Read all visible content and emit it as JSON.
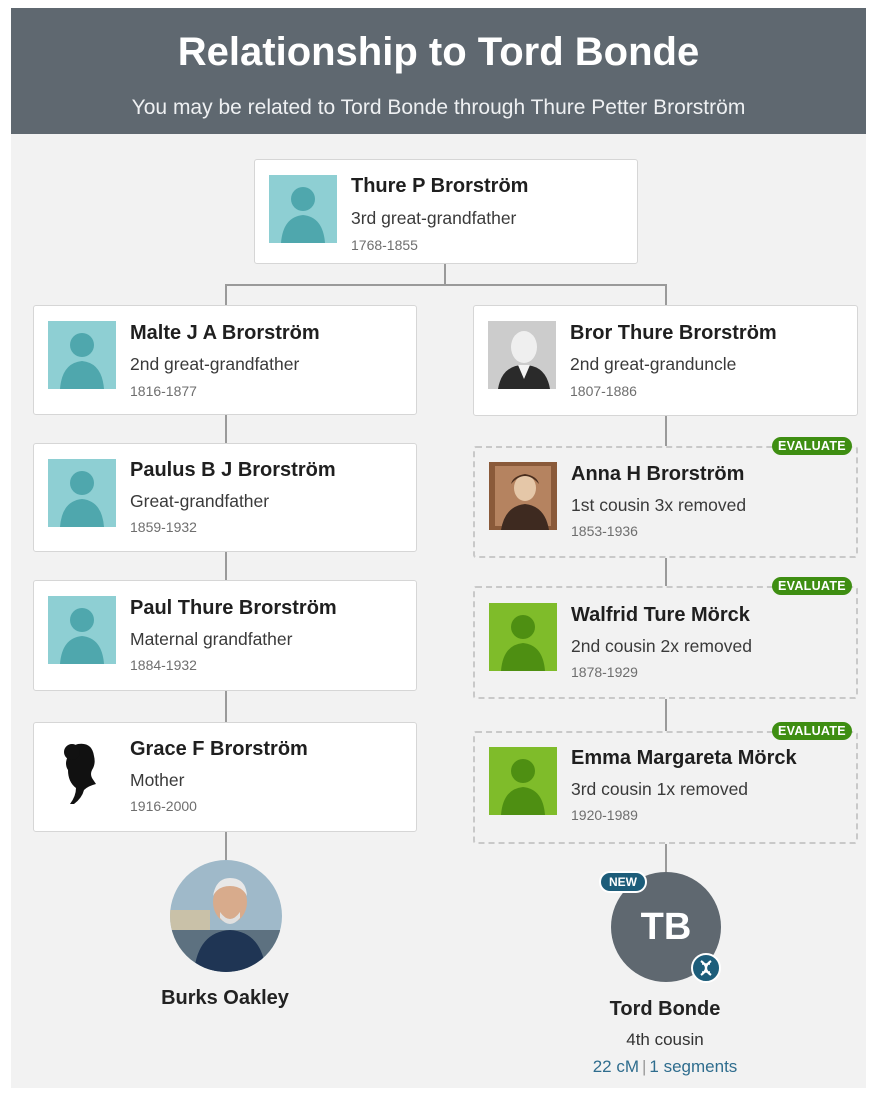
{
  "header": {
    "title": "Relationship to Tord Bonde",
    "subtitle": "You may be related to Tord Bonde through Thure Petter Brorström"
  },
  "top": {
    "name": "Thure P Brorström",
    "relation": "3rd great-grandfather",
    "years": "1768-1855"
  },
  "left_line": [
    {
      "name": "Malte J A Brorström",
      "relation": "2nd great-grandfather",
      "years": "1816-1877"
    },
    {
      "name": "Paulus B J Brorström",
      "relation": "Great-grandfather",
      "years": "1859-1932"
    },
    {
      "name": "Paul Thure Brorström",
      "relation": "Maternal grandfather",
      "years": "1884-1932"
    },
    {
      "name": "Grace F Brorström",
      "relation": "Mother",
      "years": "1916-2000"
    }
  ],
  "right_line": [
    {
      "name": "Bror Thure Brorström",
      "relation": "2nd great-granduncle",
      "years": "1807-1886"
    },
    {
      "name": "Anna H Brorström",
      "relation": "1st cousin 3x removed",
      "years": "1853-1936",
      "badge": "EVALUATE"
    },
    {
      "name": "Walfrid Ture Mörck",
      "relation": "2nd cousin 2x removed",
      "years": "1878-1929",
      "badge": "EVALUATE"
    },
    {
      "name": "Emma Margareta Mörck",
      "relation": "3rd cousin 1x removed",
      "years": "1920-1989",
      "badge": "EVALUATE"
    }
  ],
  "you": {
    "name": "Burks Oakley"
  },
  "match": {
    "initials": "TB",
    "new_badge": "NEW",
    "name": "Tord Bonde",
    "relation": "4th cousin",
    "cm": "22 cM",
    "segments": "1 segments"
  },
  "icons": {
    "placeholder_person": "silhouette-icon",
    "mother": "female-silhouette-icon",
    "dna": "dna-icon"
  },
  "colors": {
    "header_bg": "#5f6870",
    "placeholder_teal": "#8ecfd3",
    "placeholder_green": "#7fbc2a",
    "evaluate_badge": "#3e8e12",
    "new_badge": "#1d5d7a",
    "link_blue": "#2f6d8e"
  }
}
